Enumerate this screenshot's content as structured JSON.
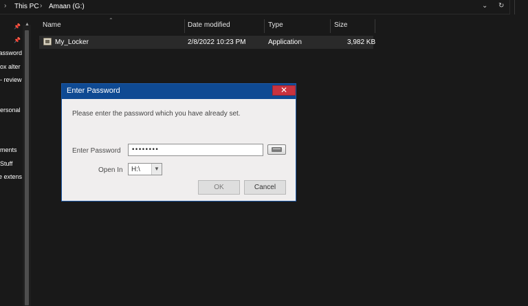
{
  "address_bar": {
    "crumbs": [
      "This PC",
      "Amaan (G:)"
    ],
    "separator": "›",
    "dropdown_icon": "chevron-down-icon",
    "refresh_icon": "refresh-icon"
  },
  "nav_pane": {
    "items": [
      {
        "label": "assword",
        "pinned": true
      },
      {
        "label": "ox alter",
        "pinned": false
      },
      {
        "label": "review -",
        "pinned": false
      },
      {
        "label": "ersonal",
        "pinned": false
      },
      {
        "label": "ments",
        "pinned": false
      },
      {
        "label": "Stuff",
        "pinned": false
      },
      {
        "label": "e extens",
        "pinned": false
      }
    ]
  },
  "file_list": {
    "columns": [
      "Name",
      "Date modified",
      "Type",
      "Size"
    ],
    "rows": [
      {
        "name": "My_Locker",
        "date": "2/8/2022 10:23 PM",
        "type": "Application",
        "size": "3,982 KB"
      }
    ]
  },
  "dialog": {
    "title": "Enter Password",
    "close_label": "✕",
    "message": "Please enter the password which you have already set.",
    "password_label": "Enter Password",
    "password_value": "••••••••",
    "open_in_label": "Open In",
    "drive_value": "H:\\",
    "ok_label": "OK",
    "cancel_label": "Cancel"
  },
  "colors": {
    "title_bar": "#0f4a93",
    "close_button": "#c9333f",
    "explorer_bg": "#191919"
  }
}
